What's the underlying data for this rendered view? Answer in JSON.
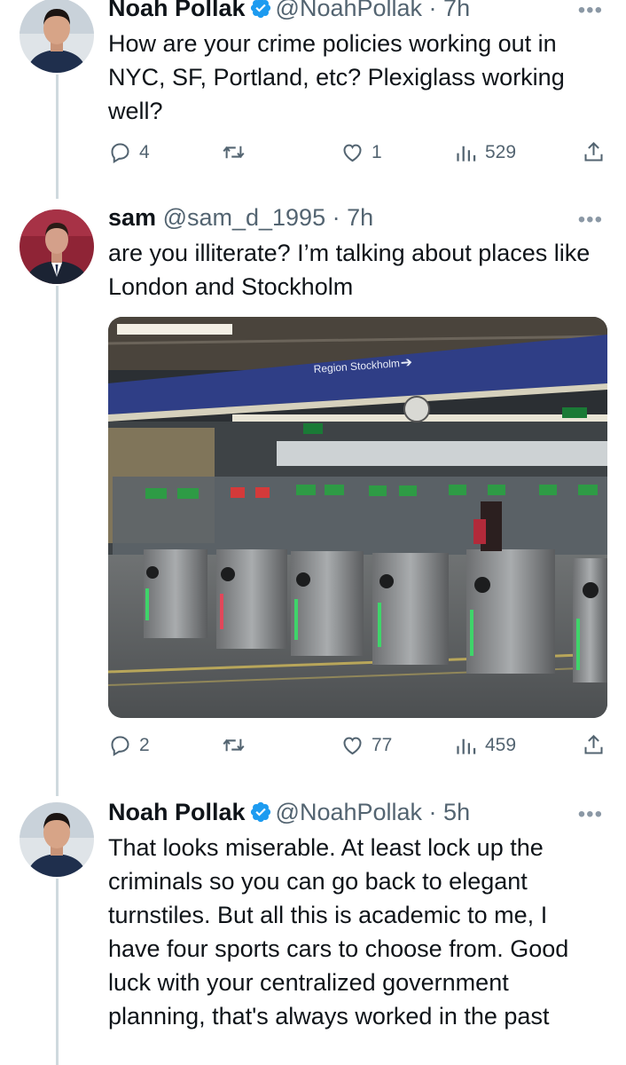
{
  "tweets": [
    {
      "name": "Noah Pollak",
      "handle": "@NoahPollak",
      "time": "7h",
      "text": "How are your crime policies working out in NYC, SF, Portland, etc? Plexiglass working well?",
      "replies": "4",
      "retweets": "",
      "likes": "1",
      "views": "529",
      "verified": true
    },
    {
      "name": "sam",
      "handle": "@sam_d_1995",
      "time": "7h",
      "text": "are you illiterate? I’m talking about places like London and Stockholm",
      "replies": "2",
      "retweets": "",
      "likes": "77",
      "views": "459",
      "verified": false,
      "media_sign": "Region Stockholm"
    },
    {
      "name": "Noah Pollak",
      "handle": "@NoahPollak",
      "time": "5h",
      "text": "That looks miserable. At least lock up the criminals so you can go back to elegant turnstiles. But all this is academic to me, I have four sports cars to choose from. Good luck with your centralized government planning, that's always worked in the past",
      "verified": true
    }
  ],
  "colors": {
    "verified_blue": "#1d9bf0",
    "muted": "#536471",
    "thread_line": "#cfd9de"
  },
  "icons": [
    "reply-icon",
    "retweet-icon",
    "like-icon",
    "views-icon",
    "share-icon",
    "verified-badge-icon",
    "more-options-icon"
  ]
}
